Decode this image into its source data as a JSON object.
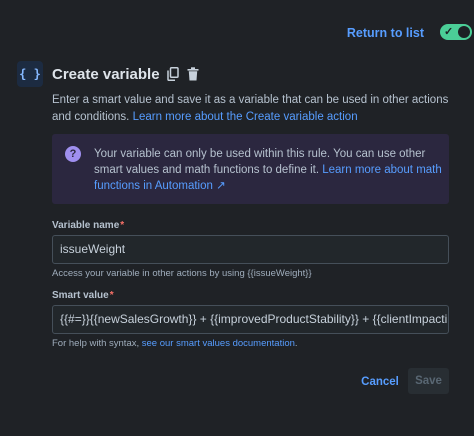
{
  "topbar": {
    "return_label": "Return to list",
    "toggle_state": "on",
    "toggle_icon": "check-icon"
  },
  "header": {
    "icon": "braces-icon",
    "icon_text": "{ }",
    "title": "Create variable",
    "actions": [
      "copy-icon",
      "trash-icon"
    ]
  },
  "description": {
    "text": "Enter a smart value and save it as a variable that can be used in other actions and conditions.",
    "link": "Learn more about the Create variable action"
  },
  "info": {
    "icon": "question-icon",
    "icon_text": "?",
    "text": "Your variable can only be used within this rule. You can use other smart values and math functions to define it.",
    "link": "Learn more about math functions in Automation ↗"
  },
  "variable_name": {
    "label": "Variable name",
    "required_mark": "*",
    "value": "issueWeight",
    "helper": "Access your variable in other actions by using {{issueWeight}}"
  },
  "smart_value": {
    "label": "Smart value",
    "required_mark": "*",
    "value": "{{#=}}{{newSalesGrowth}} + {{improvedProductStability}} + {{clientImpacting}} + {{r",
    "helper_text": "For help with syntax,",
    "helper_link": "see our smart values documentation",
    "helper_end": "."
  },
  "actions": {
    "cancel_label": "Cancel",
    "save_label": "Save"
  },
  "colors": {
    "background": "#1f2226",
    "accent": "#579dff",
    "toggle_on": "#4bce97",
    "info_bg": "#2b273f",
    "info_icon": "#9f8fef",
    "required": "#f87168"
  }
}
